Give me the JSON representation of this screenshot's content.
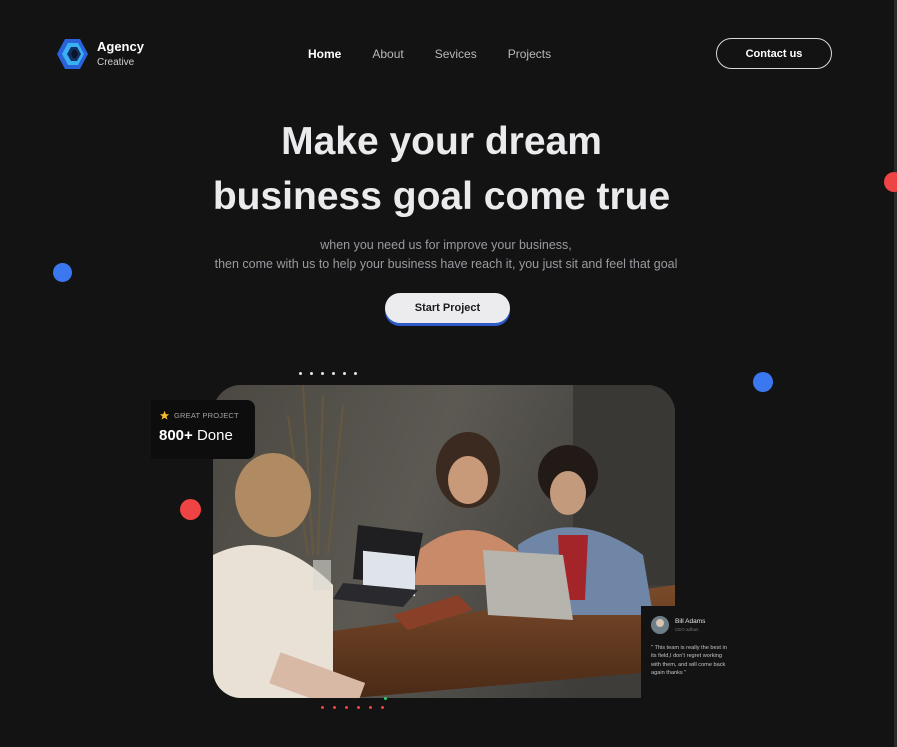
{
  "brand": {
    "name": "Agency",
    "tagline": "Creative"
  },
  "nav": {
    "items": [
      {
        "label": "Home",
        "active": true
      },
      {
        "label": "About"
      },
      {
        "label": "Sevices"
      },
      {
        "label": "Projects"
      }
    ],
    "contact_label": "Contact us"
  },
  "hero": {
    "title_line1": "Make your dream",
    "title_line2": "business goal come true",
    "subtitle_line1": "when you need us for improve your business,",
    "subtitle_line2": "then come with us to help your business have reach it, you just sit and feel that goal",
    "cta_label": "Start Project"
  },
  "stats_badge": {
    "tag": "GREAT PROJECT",
    "count": "800+",
    "suffix": "Done"
  },
  "testimonial": {
    "name": "Bill Adams",
    "role": "CEO adhan",
    "quote": "\" This team is really the best in its field,I don't regret working with them, and will come back again thanks \""
  },
  "colors": {
    "background": "#131314",
    "accent_blue": "#3b78f0",
    "accent_red": "#ef4444",
    "button_shadow": "#2f5bc8"
  },
  "icons": [
    "hexagon-logo-icon",
    "star-icon",
    "avatar"
  ]
}
